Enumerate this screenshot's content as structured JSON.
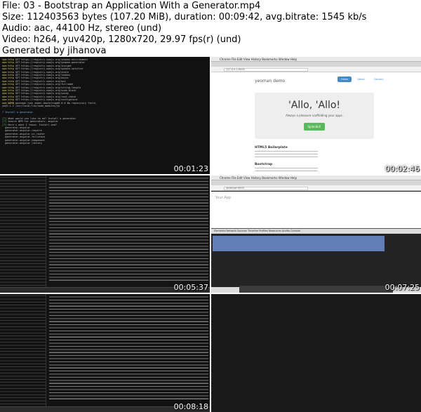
{
  "header": {
    "file": "File: 03 - Bootstrap an Application With a Generator.mp4",
    "size": "Size: 112403563 bytes (107.20 MiB), duration: 00:09:42, avg.bitrate: 1545 kb/s",
    "audio": "Audio: aac, 44100 Hz, stereo (und)",
    "video": "Video: h264, yuv420p, 1280x720, 29.97 fps(r) (und)",
    "generated": "Generated by jihanova"
  },
  "thumbnails": [
    {
      "timestamp": "00:01:23"
    },
    {
      "timestamp": "00:02:46"
    },
    {
      "timestamp": "00:05:37"
    },
    {
      "timestamp": "00:07:25"
    },
    {
      "timestamp": "00:08:18"
    }
  ],
  "browser_thumb": {
    "menu": "Chrome  File  Edit  View  History  Bookmarks  Window  Help",
    "url": "127.0.0.1:9000",
    "brand": "yeoman demo",
    "nav": [
      "Home",
      "About",
      "Contact"
    ],
    "heading": "'Allo, 'Allo!",
    "tagline": "Always a pleasure scaffolding your apps.",
    "cta": "Splendid!",
    "section1": "HTML5 Boilerplate",
    "section2": "Bootstrap"
  },
  "devtools_thumb": {
    "url": "localhost:9000",
    "page_title": "Your App",
    "tabs": "Elements  Network  Sources  Timeline  Profiles  Resources  Audits  Console"
  },
  "colors": {
    "accent": "#428bca",
    "button": "#5cb85c"
  }
}
